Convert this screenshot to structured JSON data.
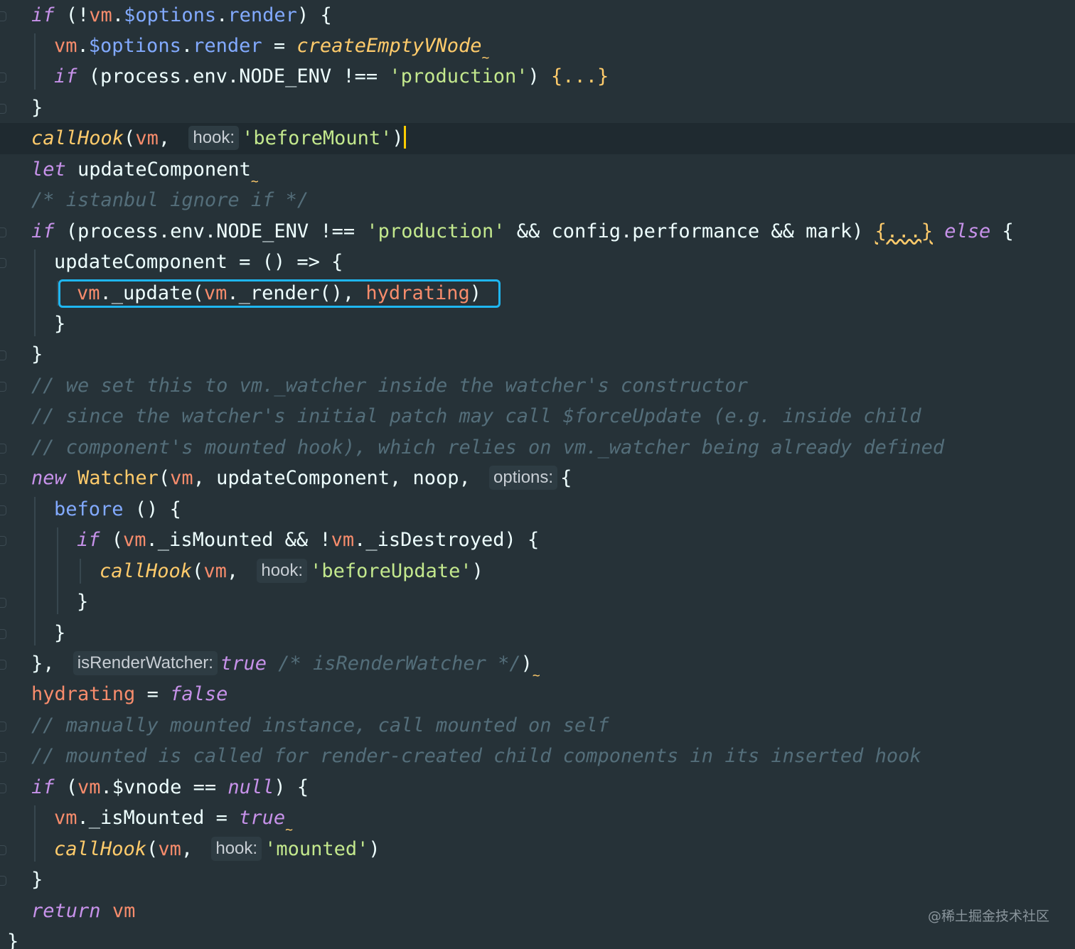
{
  "editor": {
    "theme_colors": {
      "background": "#263238",
      "keyword": "#c792ea",
      "variable": "#f78c6c",
      "property": "#82aaff",
      "string": "#c3e88d",
      "function": "#ffcb6b",
      "comment": "#546e7a",
      "plain": "#eeffff",
      "highlight_box": "#1fb6f0",
      "caret": "#ffcc00"
    },
    "lines": [
      {
        "tokens": [
          [
            "kw",
            "if"
          ],
          [
            "p",
            " (!"
          ],
          [
            "v",
            "vm"
          ],
          [
            "p",
            "."
          ],
          [
            "pr",
            "$options"
          ],
          [
            "p",
            "."
          ],
          [
            "pr",
            "render"
          ],
          [
            "p",
            ") {"
          ]
        ]
      },
      {
        "tokens": [
          [
            "v",
            "vm"
          ],
          [
            "p",
            "."
          ],
          [
            "pr",
            "$options"
          ],
          [
            "p",
            "."
          ],
          [
            "pr",
            "render"
          ],
          [
            "p",
            " = "
          ],
          [
            "fi",
            "createEmptyVNode"
          ],
          [
            "sq",
            "~"
          ]
        ]
      },
      {
        "tokens": [
          [
            "kw",
            "if"
          ],
          [
            "p",
            " (process.env.NODE_ENV !== "
          ],
          [
            "s",
            "'production'"
          ],
          [
            "p",
            ") "
          ],
          [
            "fn",
            "{...}"
          ]
        ]
      },
      {
        "tokens": [
          [
            "p",
            "}"
          ]
        ]
      },
      {
        "tokens": [
          [
            "fi",
            "callHook"
          ],
          [
            "p",
            "("
          ],
          [
            "v",
            "vm"
          ],
          [
            "p",
            ", "
          ],
          [
            "h",
            "hook:"
          ],
          [
            "s",
            "'beforeMount'"
          ],
          [
            "p",
            ")"
          ],
          [
            "c",
            ""
          ]
        ]
      },
      {
        "tokens": [
          [
            "kw",
            "let"
          ],
          [
            "p",
            " updateComponent"
          ],
          [
            "sq",
            "~"
          ]
        ]
      },
      {
        "tokens": [
          [
            "cm",
            "/* istanbul ignore if */"
          ]
        ]
      },
      {
        "tokens": [
          [
            "kw",
            "if"
          ],
          [
            "p",
            " (process.env.NODE_ENV !== "
          ],
          [
            "s",
            "'production'"
          ],
          [
            "p",
            " && config.performance && mark) "
          ],
          [
            "w",
            "{...}"
          ],
          [
            "p",
            " "
          ],
          [
            "kw",
            "else"
          ],
          [
            "p",
            " {"
          ]
        ]
      },
      {
        "tokens": [
          [
            "p",
            "updateComponent = () => {"
          ]
        ]
      },
      {
        "tokens": [
          [
            "v",
            "vm"
          ],
          [
            "p",
            "._update("
          ],
          [
            "v",
            "vm"
          ],
          [
            "p",
            "._render(), "
          ],
          [
            "v",
            "hydrating"
          ],
          [
            "p",
            ")"
          ]
        ]
      },
      {
        "tokens": [
          [
            "p",
            "}"
          ]
        ]
      },
      {
        "tokens": [
          [
            "p",
            "}"
          ]
        ]
      },
      {
        "tokens": [
          [
            "cm",
            "// we set this to vm._watcher inside the watcher's constructor"
          ]
        ]
      },
      {
        "tokens": [
          [
            "cm",
            "// since the watcher's initial patch may call $forceUpdate (e.g. inside child"
          ]
        ]
      },
      {
        "tokens": [
          [
            "cm",
            "// component's mounted hook), which relies on vm._watcher being already defined"
          ]
        ]
      },
      {
        "tokens": [
          [
            "kw",
            "new"
          ],
          [
            "p",
            " "
          ],
          [
            "fn",
            "Watcher"
          ],
          [
            "p",
            "("
          ],
          [
            "v",
            "vm"
          ],
          [
            "p",
            ", updateComponent, noop, "
          ],
          [
            "h",
            "options:"
          ],
          [
            "p",
            "{"
          ]
        ]
      },
      {
        "tokens": [
          [
            "pr",
            "before"
          ],
          [
            "p",
            " () {"
          ]
        ]
      },
      {
        "tokens": [
          [
            "kw",
            "if"
          ],
          [
            "p",
            " ("
          ],
          [
            "v",
            "vm"
          ],
          [
            "p",
            "._isMounted && !"
          ],
          [
            "v",
            "vm"
          ],
          [
            "p",
            "._isDestroyed) {"
          ]
        ]
      },
      {
        "tokens": [
          [
            "fi",
            "callHook"
          ],
          [
            "p",
            "("
          ],
          [
            "v",
            "vm"
          ],
          [
            "p",
            ", "
          ],
          [
            "h",
            "hook:"
          ],
          [
            "s",
            "'beforeUpdate'"
          ],
          [
            "p",
            ")"
          ]
        ]
      },
      {
        "tokens": [
          [
            "p",
            "}"
          ]
        ]
      },
      {
        "tokens": [
          [
            "p",
            "}"
          ]
        ]
      },
      {
        "tokens": [
          [
            "p",
            "}, "
          ],
          [
            "h",
            "isRenderWatcher:"
          ],
          [
            "kw",
            "true"
          ],
          [
            "p",
            " "
          ],
          [
            "cm",
            "/* isRenderWatcher */"
          ],
          [
            "p",
            ")"
          ],
          [
            "sq",
            "~"
          ]
        ]
      },
      {
        "tokens": [
          [
            "v",
            "hydrating"
          ],
          [
            "p",
            " = "
          ],
          [
            "kw",
            "false"
          ]
        ]
      },
      {
        "tokens": [
          [
            "cm",
            "// manually mounted instance, call mounted on self"
          ]
        ]
      },
      {
        "tokens": [
          [
            "cm",
            "// mounted is called for render-created child components in its inserted hook"
          ]
        ]
      },
      {
        "tokens": [
          [
            "kw",
            "if"
          ],
          [
            "p",
            " ("
          ],
          [
            "v",
            "vm"
          ],
          [
            "p",
            ".$vnode == "
          ],
          [
            "kw",
            "null"
          ],
          [
            "p",
            ") {"
          ]
        ]
      },
      {
        "tokens": [
          [
            "v",
            "vm"
          ],
          [
            "p",
            "._isMounted = "
          ],
          [
            "kw",
            "true"
          ],
          [
            "sq",
            "~"
          ]
        ]
      },
      {
        "tokens": [
          [
            "fi",
            "callHook"
          ],
          [
            "p",
            "("
          ],
          [
            "v",
            "vm"
          ],
          [
            "p",
            ", "
          ],
          [
            "h",
            "hook:"
          ],
          [
            "s",
            "'mounted'"
          ],
          [
            "p",
            ")"
          ]
        ]
      },
      {
        "tokens": [
          [
            "p",
            "}"
          ]
        ]
      },
      {
        "tokens": [
          [
            "kw",
            "return"
          ],
          [
            "p",
            " "
          ],
          [
            "v",
            "vm"
          ]
        ]
      },
      {
        "tokens": [
          [
            "p",
            "}"
          ]
        ]
      }
    ]
  },
  "watermark": "@稀土掘金技术社区"
}
